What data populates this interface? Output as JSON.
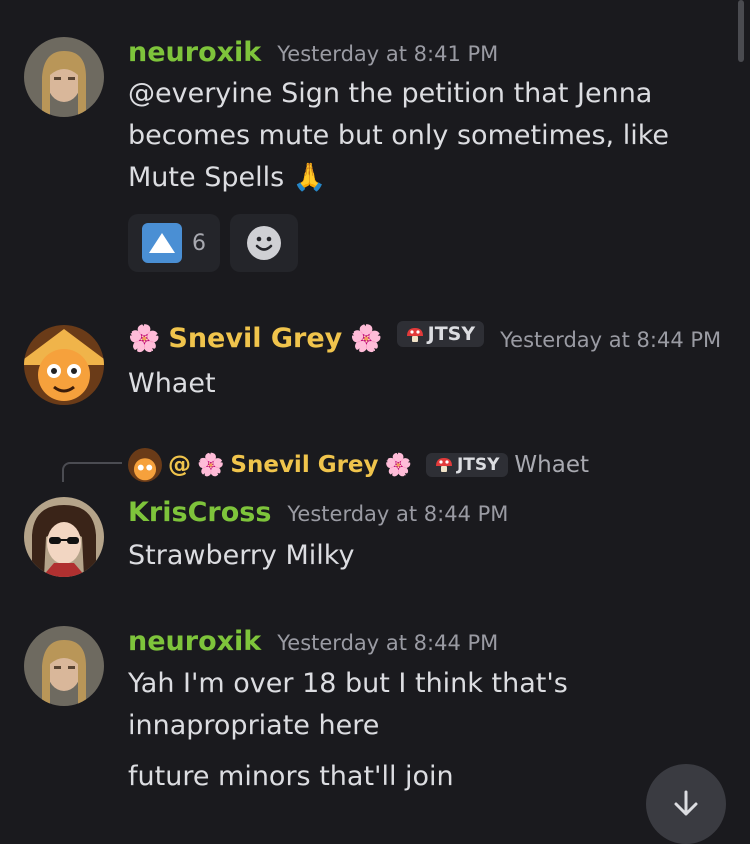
{
  "messages": [
    {
      "username": "neuroxik",
      "timestamp": "Yesterday at 8:41 PM",
      "lines": [
        "@everyine Sign the petition that Jenna",
        "becomes mute but only sometimes, like",
        "Mute Spells 🙏"
      ],
      "reactions": [
        {
          "icon": "up-arrow-icon",
          "count": "6"
        },
        {
          "icon": "add-reaction-icon"
        }
      ]
    },
    {
      "username": "Snevil Grey",
      "flower": "🌸",
      "badge": "JTSY",
      "timestamp": "Yesterday at 8:44 PM",
      "lines": [
        "Whaet"
      ]
    },
    {
      "reply": {
        "prefix": "@",
        "username": "Snevil Grey",
        "badge": "JTSY",
        "text": "Whaet"
      },
      "username": "KrisCross",
      "timestamp": "Yesterday at 8:44 PM",
      "lines": [
        "Strawberry Milky"
      ]
    },
    {
      "username": "neuroxik",
      "timestamp": "Yesterday at 8:44 PM",
      "lines": [
        "Yah I'm over 18 but I think that's",
        "innapropriate here"
      ],
      "followup": "future minors that'll join"
    }
  ],
  "colors": {
    "background": "#1a1a1e",
    "green_name": "#7ec43b",
    "yellow_name": "#f0c44c",
    "timestamp": "#9a9ba3"
  },
  "scroll_button_icon": "arrow-down-icon"
}
